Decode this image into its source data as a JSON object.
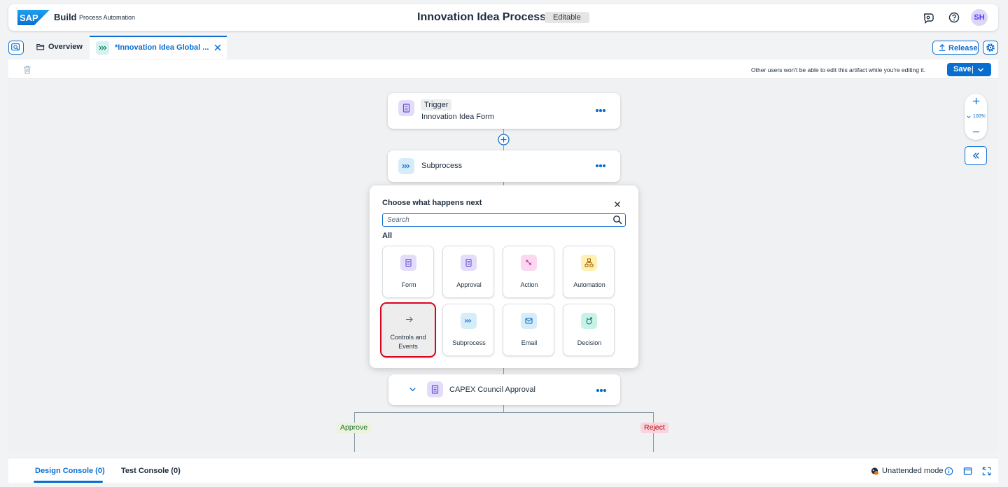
{
  "shell": {
    "brand_logo": "SAP",
    "brand_name": "Build",
    "brand_sub": "Process Automation",
    "title": "Innovation Idea Process",
    "status_badge": "Editable",
    "avatar_initials": "SH",
    "icons": [
      "joule-icon",
      "help-icon"
    ]
  },
  "tabs": {
    "overview_label": "Overview",
    "active_label": "*Innovation Idea Global ..."
  },
  "actions": {
    "release_label": "Release",
    "save_label": "Save"
  },
  "toolbar": {
    "notice": "Other users won't be able to edit this artifact while you're editing it."
  },
  "canvas": {
    "zoom_level": "100%",
    "trigger": {
      "tag": "Trigger",
      "name": "Innovation Idea Form"
    },
    "subprocess": {
      "name": "Subprocess"
    },
    "approval": {
      "name": "CAPEX Council Approval"
    },
    "branches": {
      "approve": "Approve",
      "reject": "Reject"
    }
  },
  "popover": {
    "title": "Choose what happens next",
    "search_placeholder": "Search",
    "section_label": "All",
    "tiles": [
      {
        "label": "Form",
        "icon": "form-icon"
      },
      {
        "label": "Approval",
        "icon": "approval-icon"
      },
      {
        "label": "Action",
        "icon": "action-icon"
      },
      {
        "label": "Automation",
        "icon": "automation-icon"
      },
      {
        "label": "Controls and Events",
        "icon": "arrow-right-icon"
      },
      {
        "label": "Subprocess",
        "icon": "subprocess-icon"
      },
      {
        "label": "Email",
        "icon": "email-icon"
      },
      {
        "label": "Decision",
        "icon": "decision-icon"
      }
    ]
  },
  "console": {
    "design_tab": "Design Console (0)",
    "test_tab": "Test Console (0)",
    "mode_label": "Unattended mode"
  },
  "colors": {
    "accent": "#0a6ed1",
    "selection_outline": "#d9041f",
    "approve_badge": "#eaf4d9",
    "reject_badge": "#fad3dc"
  }
}
